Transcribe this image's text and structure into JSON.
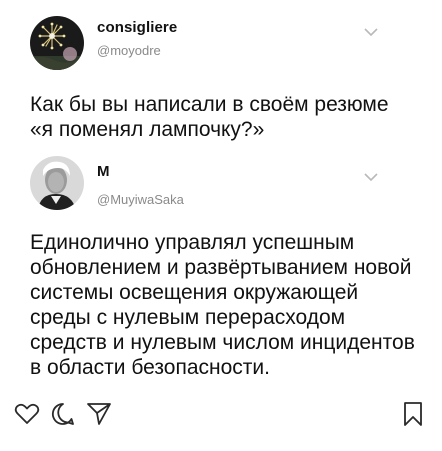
{
  "tweets": [
    {
      "author_name": "consigliere",
      "author_handle": "@moyodre",
      "text": "Как бы вы написали в своём резюме\n«я поменял лампочку?»",
      "avatar_icon": "fireworks-avatar-icon",
      "menu_icon": "chevron-down-icon"
    },
    {
      "author_name": "M",
      "author_handle": "@MuyiwaSaka",
      "text": "Единолично управлял успешным\nобновлением и развёртыванием новой\nсистемы освещения окружающей\nсреды с нулевым перерасходом\nсредств и нулевым числом инцидентов\nв области безопасности.",
      "avatar_icon": "portrait-avatar-icon",
      "menu_icon": "chevron-down-icon"
    }
  ],
  "actions": {
    "like_icon": "heart-icon",
    "comment_icon": "comment-icon",
    "share_icon": "send-icon",
    "save_icon": "bookmark-icon"
  },
  "colors": {
    "text": "#111111",
    "handle": "#8a8a8a",
    "chevron": "#b9b9b9"
  }
}
